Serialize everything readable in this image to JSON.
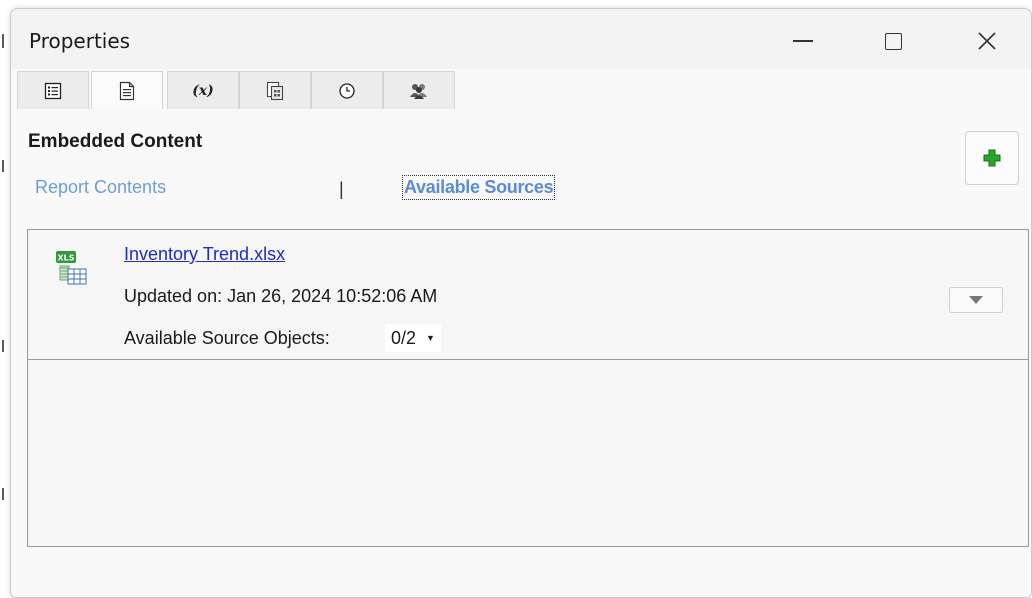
{
  "window": {
    "title": "Properties"
  },
  "tabs": [
    {
      "icon": "list-icon"
    },
    {
      "icon": "document-icon",
      "active": true
    },
    {
      "icon": "variable-icon",
      "label": "(x)"
    },
    {
      "icon": "report-icon"
    },
    {
      "icon": "clock-icon"
    },
    {
      "icon": "users-icon"
    }
  ],
  "content": {
    "heading": "Embedded Content",
    "view_tabs": {
      "report_contents": "Report Contents",
      "separator": "|",
      "available_sources": "Available Sources"
    },
    "add_button_icon": "plus-icon"
  },
  "sources": [
    {
      "icon": "xls-file-icon",
      "icon_badge": "XLS",
      "name": "Inventory Trend.xlsx",
      "updated": "Updated on: Jan 26, 2024 10:52:06 AM",
      "objects_label": "Available Source Objects:",
      "objects_value": "0/2"
    }
  ],
  "colors": {
    "link": "#1f2bc4",
    "tab_link": "#6e9cd8",
    "active_tab_link": "#5b8bd5",
    "add_green": "#2aa52a"
  }
}
